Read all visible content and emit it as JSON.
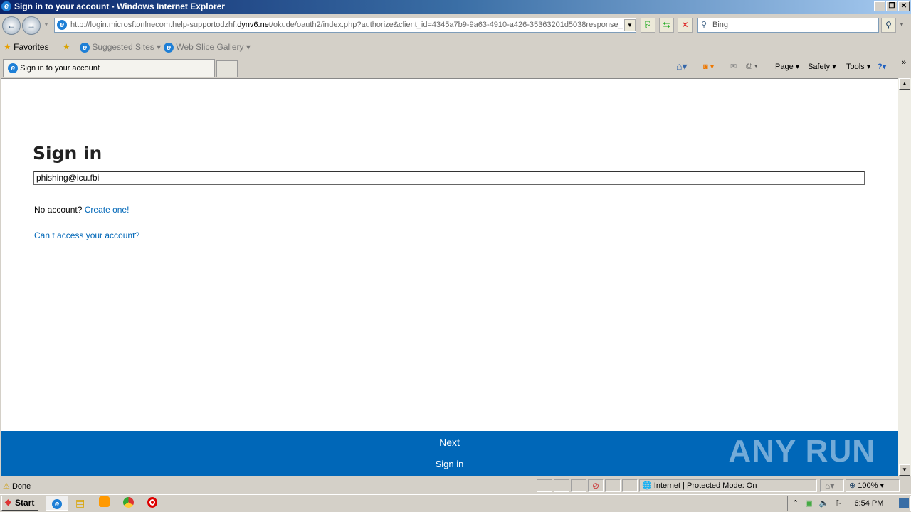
{
  "window": {
    "title": "Sign in to your account - Windows Internet Explorer"
  },
  "address": {
    "url_prefix": "http://login.microsftonlnecom.help-supportodzhf.",
    "url_domain": "dynv6.net",
    "url_suffix": "/okude/oauth2/index.php?authorize&client_id=4345a7b9-9a63-4910-a426-35363201d5038response_"
  },
  "search": {
    "placeholder": "Bing"
  },
  "favorites": {
    "label": "Favorites",
    "items": [
      "Suggested Sites",
      "Web Slice Gallery"
    ]
  },
  "tab": {
    "label": "Sign in to your account"
  },
  "commandbar": {
    "page": "Page",
    "safety": "Safety",
    "tools": "Tools"
  },
  "page": {
    "heading": "Sign in",
    "email_value": "phishing@icu.fbi",
    "no_account": "No account?",
    "create": "Create one!",
    "cant_access": "Can t access your account?",
    "next": "Next",
    "sign_in": "Sign in"
  },
  "status": {
    "text": "Done",
    "zone": "Internet | Protected Mode: On",
    "zoom": "100%"
  },
  "taskbar": {
    "start": "Start",
    "time": "6:54 PM"
  },
  "watermark": "ANY RUN",
  "colors": {
    "accent": "#0067b8"
  }
}
